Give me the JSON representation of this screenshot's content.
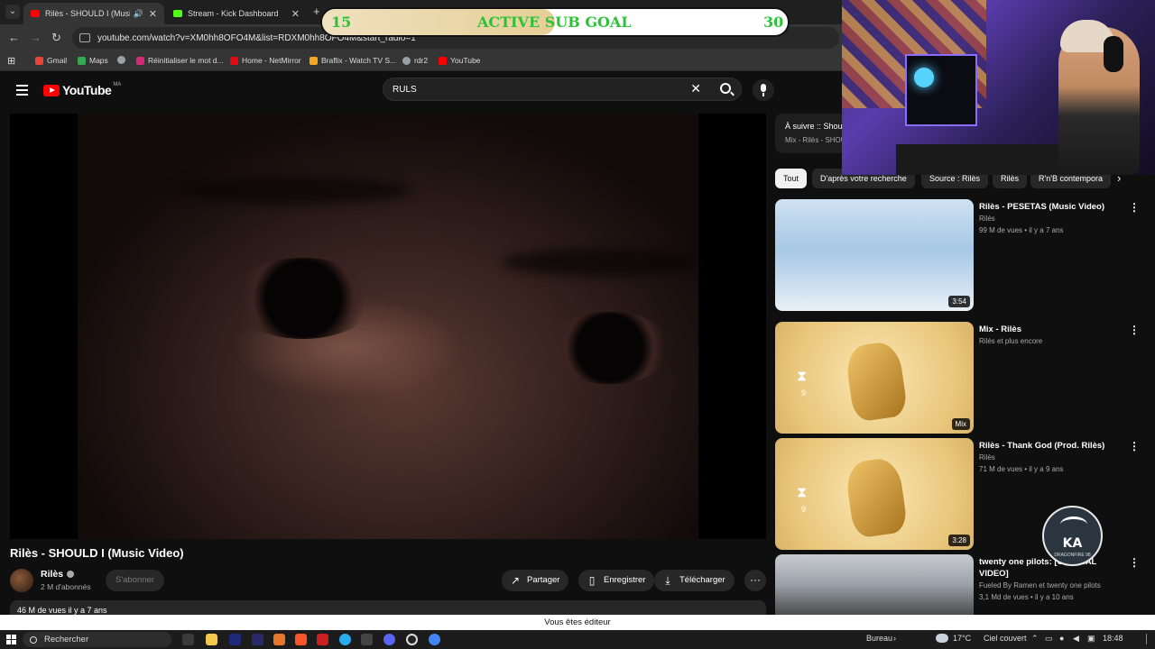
{
  "browser": {
    "tabs": [
      {
        "title": "Rilès - SHOULD I (Music Vid",
        "active": true,
        "favicon_color": "#ff0000"
      },
      {
        "title": "Stream - Kick Dashboard",
        "active": false,
        "favicon_color": "#53fc18"
      }
    ],
    "url": "youtube.com/watch?v=XM0hh8OFO4M&list=RDXM0hh8OFO4M&start_radio=1",
    "bookmarks": [
      {
        "label": "Gmail",
        "color": "#ea4335"
      },
      {
        "label": "Maps",
        "color": "#34a853"
      },
      {
        "label": "",
        "color": "#9aa0a6"
      },
      {
        "label": "Réinitialiser le mot d...",
        "color": "#d62976"
      },
      {
        "label": "Home - NetMirror",
        "color": "#e50914"
      },
      {
        "label": "Braflix - Watch TV S...",
        "color": "#f5a623"
      },
      {
        "label": "rdr2",
        "color": "#9aa0a6"
      },
      {
        "label": "YouTube",
        "color": "#ff0000"
      }
    ]
  },
  "youtube": {
    "logo_text": "YouTube",
    "country_code": "MA",
    "search_value": "RULS",
    "video": {
      "title": "Rilès - SHOULD I (Music Video)",
      "channel": "Rilès",
      "subscribers": "2 M d'abonnés",
      "subscribe_label": "S'abonner",
      "actions": {
        "share": "Partager",
        "save": "Enregistrer",
        "download": "Télécharger"
      },
      "description_meta": "46 M de vues  il y a 7 ans"
    },
    "up_next": {
      "title": "À suivre :: Shoul",
      "subtitle": "Mix - Rilès - SHOU"
    },
    "chips": [
      {
        "label": "Tout",
        "selected": true
      },
      {
        "label": "D'après votre recherche",
        "selected": false
      },
      {
        "label": "Source : Rilès",
        "selected": false
      },
      {
        "label": "Rilès",
        "selected": false
      },
      {
        "label": "R'n'B contempora",
        "selected": false
      }
    ],
    "recommendations": [
      {
        "title": "Rilès - PESETAS (Music Video)",
        "channel": "Rilès",
        "meta": "99 M de vues • il y a 7 ans",
        "duration": "3:54",
        "verified": true
      },
      {
        "title": "Mix - Rilès",
        "channel": "Rilès et plus encore",
        "meta": "",
        "duration": "Mix",
        "hourglass_count": "9",
        "verified": false
      },
      {
        "title": "Rilès - Thank God (Prod. Rilès)",
        "channel": "Rilès",
        "meta": "71 M de vues • il y a 9 ans",
        "duration": "3:28",
        "hourglass_count": "9",
        "verified": true
      },
      {
        "title": "twenty one pilots: [OFFICIAL VIDEO]",
        "channel": "Fueled By Ramen et twenty one pilots",
        "meta": "3,1 Md de vues • il y a 10 ans",
        "duration": "",
        "verified": true
      }
    ]
  },
  "overlay": {
    "subgoal": {
      "current": "15",
      "label": "ACTIVE SUB GOAL",
      "target": "30",
      "progress": 0.5
    },
    "badge": {
      "mark": "KA",
      "sub": "DRAGONFIRE 98"
    }
  },
  "editor_notice": "Vous êtes éditeur",
  "taskbar": {
    "search_label": "Rechercher",
    "desktop_label": "Bureau",
    "temperature": "17°C",
    "weather": "Ciel couvert",
    "time": "18:48"
  }
}
